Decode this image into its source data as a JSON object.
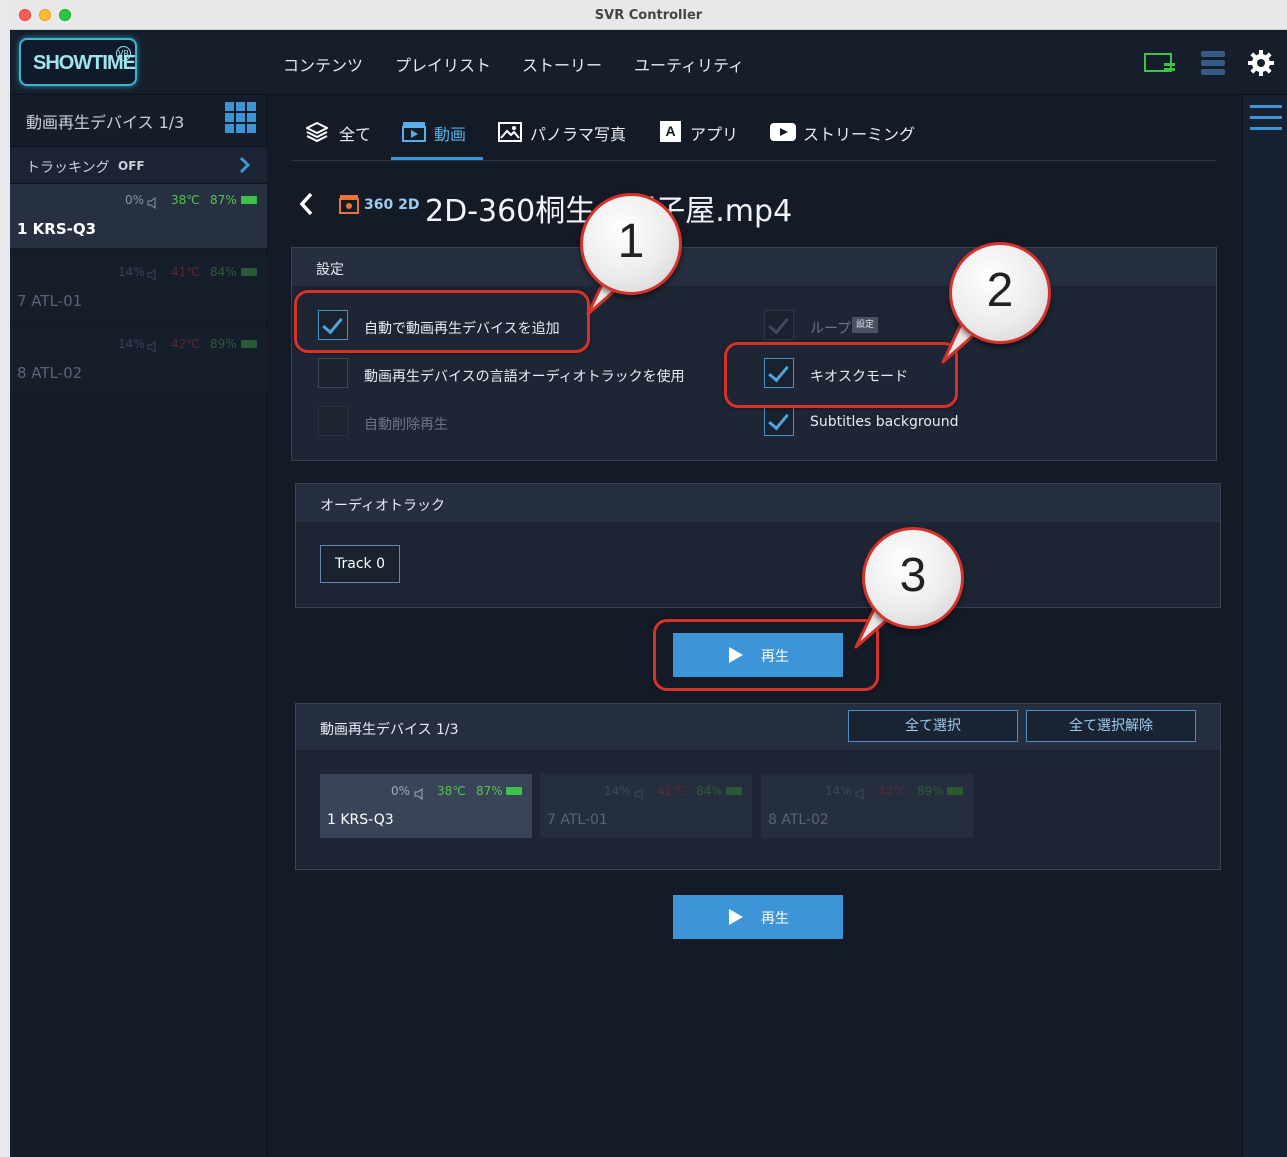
{
  "window": {
    "title": "SVR Controller"
  },
  "logo": {
    "text": "SHOWTIME",
    "badge": "VR"
  },
  "nav": [
    "コンテンツ",
    "プレイリスト",
    "ストーリー",
    "ユーティリティ"
  ],
  "sidebar": {
    "header": "動画再生デバイス 1/3",
    "tracking_label": "トラッキング",
    "tracking_value": "OFF",
    "devices": [
      {
        "name": "1 KRS-Q3",
        "volume": "0%",
        "temp": "38℃",
        "battery": "87%",
        "active": true
      },
      {
        "name": "7 ATL-01",
        "volume": "14%",
        "temp": "41℃",
        "battery": "84%",
        "active": false
      },
      {
        "name": "8 ATL-02",
        "volume": "14%",
        "temp": "42℃",
        "battery": "89%",
        "active": false
      }
    ]
  },
  "tabs": [
    "全て",
    "動画",
    "パノラマ写真",
    "アプリ",
    "ストリーミング"
  ],
  "tab_active": "動画",
  "content": {
    "badge": "360 2D",
    "title": "2D-360桐生の帽子屋.mp4"
  },
  "settings": {
    "header": "設定",
    "options": [
      {
        "label": "自動で動画再生デバイスを追加",
        "checked": true,
        "enabled": true
      },
      {
        "label": "動画再生デバイスの言語オーディオトラックを使用",
        "checked": false,
        "enabled": true
      },
      {
        "label": "自動削除再生",
        "checked": false,
        "enabled": false
      },
      {
        "label": "ループ",
        "checked": true,
        "enabled": false,
        "tag": "設定"
      },
      {
        "label": "キオスクモード",
        "checked": true,
        "enabled": true
      },
      {
        "label": "Subtitles background",
        "checked": true,
        "enabled": true
      }
    ]
  },
  "audio": {
    "header": "オーディオトラック",
    "track": "Track 0"
  },
  "play_label": "再生",
  "devices_panel": {
    "header": "動画再生デバイス 1/3",
    "select_all": "全て選択",
    "deselect_all": "全て選択解除"
  },
  "callouts": [
    "1",
    "2",
    "3"
  ],
  "colors": {
    "accent": "#3d94d6",
    "highlight": "#d6322a",
    "battery_green": "#3fc24a",
    "temp_green": "#58c25a"
  },
  "icons": [
    "grid-icon",
    "chevron-right-icon",
    "back-icon",
    "layers-icon",
    "video-icon",
    "panorama-icon",
    "app-icon",
    "streaming-icon",
    "gear-icon",
    "server-icon",
    "display-icon",
    "menu-icon",
    "speaker-icon",
    "battery-icon",
    "play-icon"
  ]
}
